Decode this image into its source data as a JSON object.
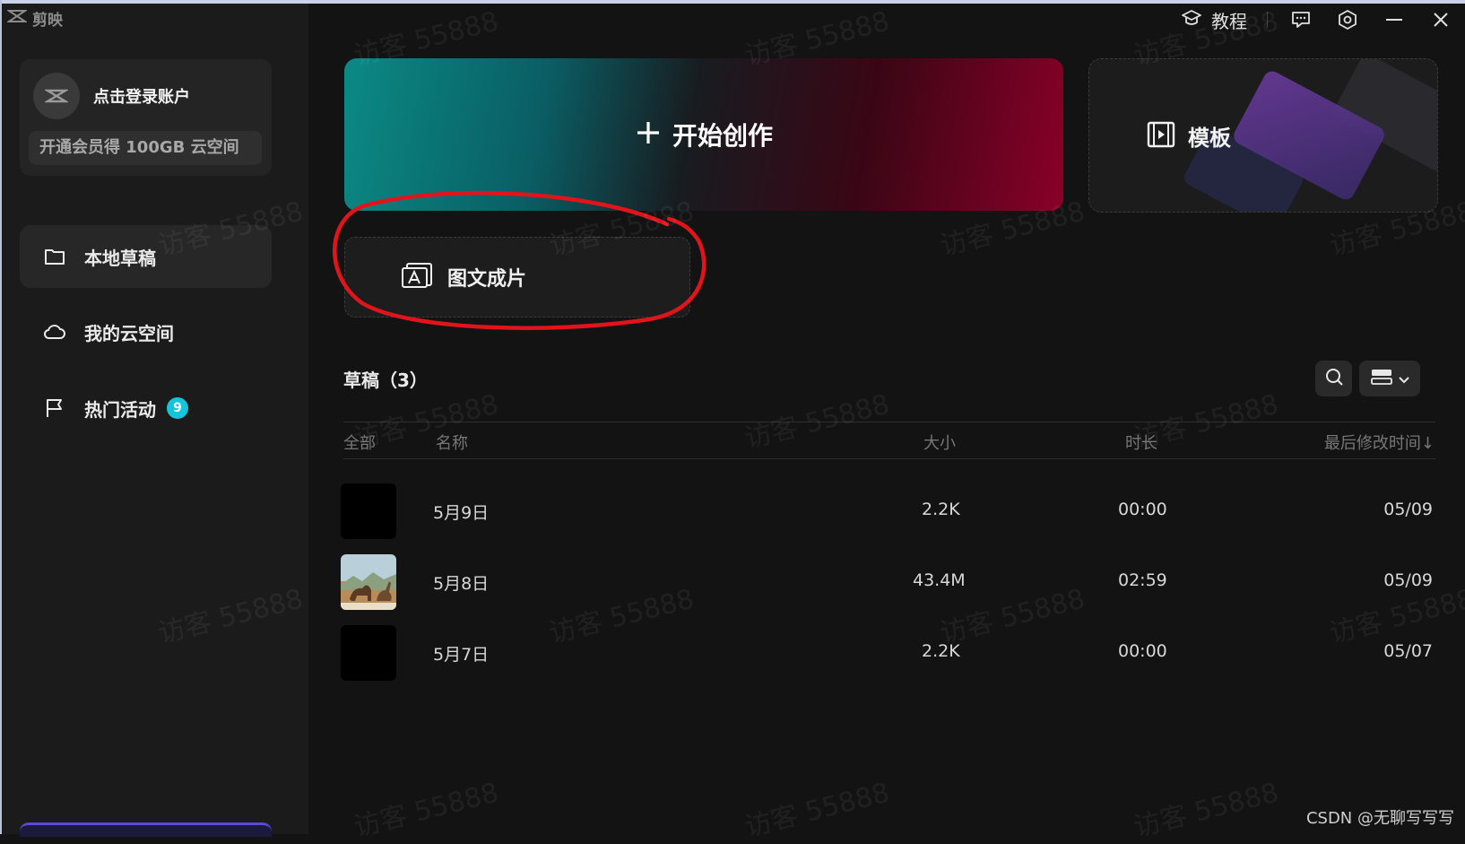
{
  "app": {
    "name": "剪映"
  },
  "account": {
    "login_label": "点击登录账户",
    "vip_banner": "开通会员得 100GB 云空间"
  },
  "sidebar": {
    "items": [
      {
        "label": "本地草稿",
        "icon": "folder-icon",
        "active": true
      },
      {
        "label": "我的云空间",
        "icon": "cloud-icon",
        "active": false
      },
      {
        "label": "热门活动",
        "icon": "flag-icon",
        "active": false,
        "badge": "9"
      }
    ]
  },
  "topbar": {
    "tutorial_label": "教程"
  },
  "main": {
    "create_label": "开始创作",
    "template_label": "模板",
    "imgtext_label": "图文成片"
  },
  "drafts": {
    "title": "草稿（3）",
    "columns": {
      "select_all": "全部",
      "name": "名称",
      "size": "大小",
      "duration": "时长",
      "modified": "最后修改时间↓"
    },
    "rows": [
      {
        "name": "5月9日",
        "size": "2.2K",
        "duration": "00:00",
        "modified": "05/09",
        "thumb": "blank"
      },
      {
        "name": "5月8日",
        "size": "43.4M",
        "duration": "02:59",
        "modified": "05/09",
        "thumb": "dinosaur-scene"
      },
      {
        "name": "5月7日",
        "size": "2.2K",
        "duration": "00:00",
        "modified": "05/07",
        "thumb": "blank"
      }
    ]
  },
  "watermark_text": "访客 55888",
  "footer_credit": "CSDN @无聊写写写"
}
